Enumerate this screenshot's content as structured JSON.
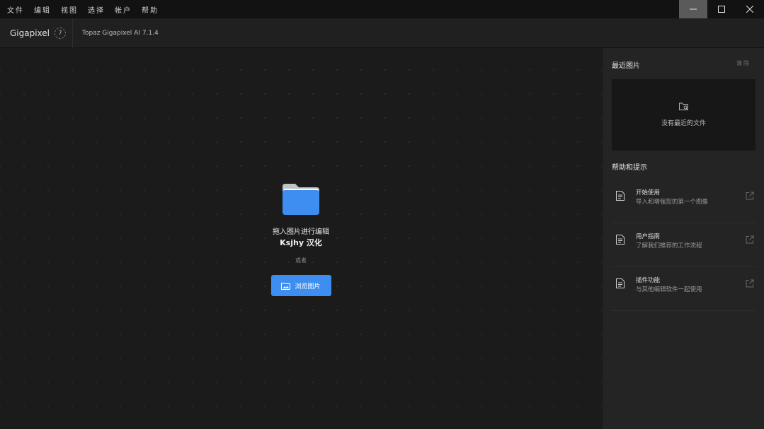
{
  "menu": [
    "文件",
    "编辑",
    "视图",
    "选择",
    "帐户",
    "帮助"
  ],
  "window": {
    "minimize": "minimize-icon",
    "maximize": "maximize-icon",
    "close": "close-icon"
  },
  "header": {
    "brand": "Gigapixel",
    "badge": "7",
    "version": "Topaz Gigapixel AI 7.1.4"
  },
  "drop": {
    "line1": "拖入图片进行编辑",
    "line2": "Ksjhy 汉化",
    "or": "或者",
    "browse_label": "浏览图片"
  },
  "recent": {
    "title": "最近图片",
    "clear": "清除",
    "empty": "没有最近的文件"
  },
  "help": {
    "title": "帮助和提示",
    "items": [
      {
        "name": "开始使用",
        "desc": "导入和增强您的第一个图像"
      },
      {
        "name": "用户指南",
        "desc": "了解我们推荐的工作流程"
      },
      {
        "name": "插件功能",
        "desc": "与其他编辑软件一起使用"
      }
    ]
  },
  "colors": {
    "accent": "#3d8ef0",
    "folder": "#3d8ef0"
  }
}
